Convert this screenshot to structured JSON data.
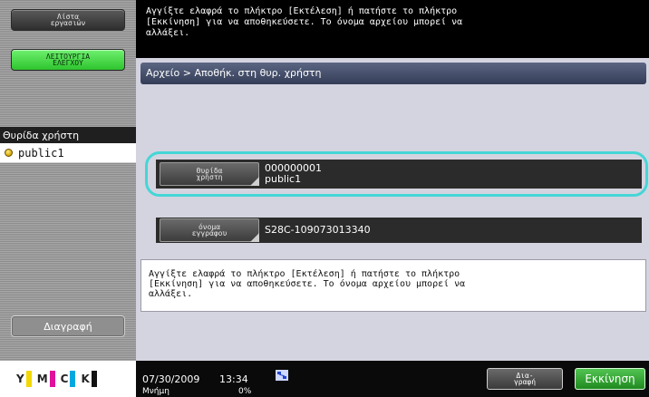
{
  "sidebar": {
    "jobs_button": "Λίστα\nεργασιών",
    "function_button": "ΛΕΙΤΟΥΡΓΙΑ\nΕΛΕΓΧΟΥ",
    "header": "Θυρίδα χρήστη",
    "selected_box": "public1",
    "delete_button": "Διαγραφή",
    "toner": [
      {
        "label": "Y",
        "color": "#f2d800"
      },
      {
        "label": "M",
        "color": "#e0109a"
      },
      {
        "label": "C",
        "color": "#00a8e0"
      },
      {
        "label": "K",
        "color": "#111111"
      }
    ]
  },
  "top_message": "Αγγίξτε ελαφρά το πλήκτρο [Εκτέλεση] ή πατήστε το πλήκτρο\n[Εκκίνηση] για να αποθηκεύσετε. Το όνομα αρχείου μπορεί να\nαλλάξει.",
  "breadcrumb": "Αρχείο > Αποθήκ. στη θυρ. χρήστη",
  "user_box": {
    "button_label": "Θυρίδα\nχρήστη",
    "value": "000000001\npublic1"
  },
  "file_name": {
    "button_label": "όνομα\nεγγράφου",
    "value": "S28C-109073013340"
  },
  "message_box": "Αγγίξτε ελαφρά το πλήκτρο [Εκτέλεση] ή πατήστε το πλήκτρο\n[Εκκίνηση] για να αποθηκεύσετε. Το όνομα αρχείου μπορεί να\nαλλάξει.",
  "status_bar": {
    "date": "07/30/2009",
    "time": "13:34",
    "memory_label": "Μνήμη",
    "memory_value": "0%",
    "preview_button": "Δια-\nγραφή",
    "start_button": "Εκκίνηση"
  },
  "colors": {
    "highlight": "#45d6d6",
    "start_green": "#2ec42e",
    "breadcrumb_bar": "#46506c"
  }
}
